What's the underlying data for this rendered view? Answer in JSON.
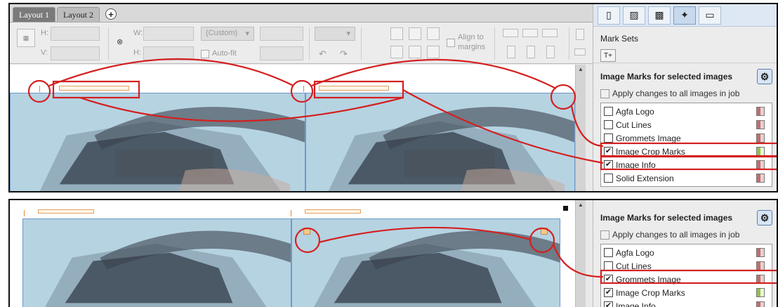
{
  "tabs": [
    {
      "label": "Layout 1",
      "active": true
    },
    {
      "label": "Layout 2",
      "active": false
    }
  ],
  "toolbar": {
    "h_label": "H:",
    "v_label": "V:",
    "w_label": "W:",
    "h2_label": "H:",
    "size_select": "(Custom)",
    "autofit_label": "Auto-fit",
    "align_label_1": "Align to",
    "align_label_2": "margins"
  },
  "right_panel": {
    "mark_sets_label": "Mark Sets",
    "section_title": "Image Marks for selected images",
    "apply_label": "Apply changes to all images in job",
    "marks": [
      {
        "name": "Agfa Logo",
        "checked": false
      },
      {
        "name": "Cut Lines",
        "checked": false
      },
      {
        "name": "Grommets Image",
        "checked": false
      },
      {
        "name": "Image Crop Marks",
        "checked": true
      },
      {
        "name": "Image Info",
        "checked": true
      },
      {
        "name": "Solid Extension",
        "checked": false
      }
    ]
  },
  "right_panel_2": {
    "section_title": "Image Marks for selected images",
    "apply_label": "Apply changes to all images in job",
    "marks": [
      {
        "name": "Agfa Logo",
        "checked": false
      },
      {
        "name": "Cut Lines",
        "checked": false
      },
      {
        "name": "Grommets Image",
        "checked": true
      },
      {
        "name": "Image Crop Marks",
        "checked": true
      },
      {
        "name": "Image Info",
        "checked": true
      }
    ]
  },
  "colors": {
    "annotation": "#d42020",
    "page_fill": "#b6d3e2",
    "swatch_on": "#8fc24c",
    "swatch_off": "#c06e6e"
  }
}
